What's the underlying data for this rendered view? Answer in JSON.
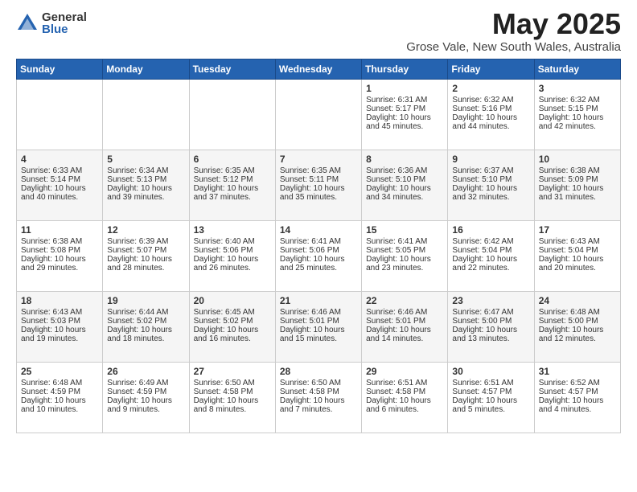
{
  "logo": {
    "general": "General",
    "blue": "Blue"
  },
  "title": "May 2025",
  "subtitle": "Grose Vale, New South Wales, Australia",
  "days_of_week": [
    "Sunday",
    "Monday",
    "Tuesday",
    "Wednesday",
    "Thursday",
    "Friday",
    "Saturday"
  ],
  "weeks": [
    [
      {
        "day": "",
        "sunrise": "",
        "sunset": "",
        "daylight": ""
      },
      {
        "day": "",
        "sunrise": "",
        "sunset": "",
        "daylight": ""
      },
      {
        "day": "",
        "sunrise": "",
        "sunset": "",
        "daylight": ""
      },
      {
        "day": "",
        "sunrise": "",
        "sunset": "",
        "daylight": ""
      },
      {
        "day": "1",
        "sunrise": "Sunrise: 6:31 AM",
        "sunset": "Sunset: 5:17 PM",
        "daylight": "Daylight: 10 hours and 45 minutes."
      },
      {
        "day": "2",
        "sunrise": "Sunrise: 6:32 AM",
        "sunset": "Sunset: 5:16 PM",
        "daylight": "Daylight: 10 hours and 44 minutes."
      },
      {
        "day": "3",
        "sunrise": "Sunrise: 6:32 AM",
        "sunset": "Sunset: 5:15 PM",
        "daylight": "Daylight: 10 hours and 42 minutes."
      }
    ],
    [
      {
        "day": "4",
        "sunrise": "Sunrise: 6:33 AM",
        "sunset": "Sunset: 5:14 PM",
        "daylight": "Daylight: 10 hours and 40 minutes."
      },
      {
        "day": "5",
        "sunrise": "Sunrise: 6:34 AM",
        "sunset": "Sunset: 5:13 PM",
        "daylight": "Daylight: 10 hours and 39 minutes."
      },
      {
        "day": "6",
        "sunrise": "Sunrise: 6:35 AM",
        "sunset": "Sunset: 5:12 PM",
        "daylight": "Daylight: 10 hours and 37 minutes."
      },
      {
        "day": "7",
        "sunrise": "Sunrise: 6:35 AM",
        "sunset": "Sunset: 5:11 PM",
        "daylight": "Daylight: 10 hours and 35 minutes."
      },
      {
        "day": "8",
        "sunrise": "Sunrise: 6:36 AM",
        "sunset": "Sunset: 5:10 PM",
        "daylight": "Daylight: 10 hours and 34 minutes."
      },
      {
        "day": "9",
        "sunrise": "Sunrise: 6:37 AM",
        "sunset": "Sunset: 5:10 PM",
        "daylight": "Daylight: 10 hours and 32 minutes."
      },
      {
        "day": "10",
        "sunrise": "Sunrise: 6:38 AM",
        "sunset": "Sunset: 5:09 PM",
        "daylight": "Daylight: 10 hours and 31 minutes."
      }
    ],
    [
      {
        "day": "11",
        "sunrise": "Sunrise: 6:38 AM",
        "sunset": "Sunset: 5:08 PM",
        "daylight": "Daylight: 10 hours and 29 minutes."
      },
      {
        "day": "12",
        "sunrise": "Sunrise: 6:39 AM",
        "sunset": "Sunset: 5:07 PM",
        "daylight": "Daylight: 10 hours and 28 minutes."
      },
      {
        "day": "13",
        "sunrise": "Sunrise: 6:40 AM",
        "sunset": "Sunset: 5:06 PM",
        "daylight": "Daylight: 10 hours and 26 minutes."
      },
      {
        "day": "14",
        "sunrise": "Sunrise: 6:41 AM",
        "sunset": "Sunset: 5:06 PM",
        "daylight": "Daylight: 10 hours and 25 minutes."
      },
      {
        "day": "15",
        "sunrise": "Sunrise: 6:41 AM",
        "sunset": "Sunset: 5:05 PM",
        "daylight": "Daylight: 10 hours and 23 minutes."
      },
      {
        "day": "16",
        "sunrise": "Sunrise: 6:42 AM",
        "sunset": "Sunset: 5:04 PM",
        "daylight": "Daylight: 10 hours and 22 minutes."
      },
      {
        "day": "17",
        "sunrise": "Sunrise: 6:43 AM",
        "sunset": "Sunset: 5:04 PM",
        "daylight": "Daylight: 10 hours and 20 minutes."
      }
    ],
    [
      {
        "day": "18",
        "sunrise": "Sunrise: 6:43 AM",
        "sunset": "Sunset: 5:03 PM",
        "daylight": "Daylight: 10 hours and 19 minutes."
      },
      {
        "day": "19",
        "sunrise": "Sunrise: 6:44 AM",
        "sunset": "Sunset: 5:02 PM",
        "daylight": "Daylight: 10 hours and 18 minutes."
      },
      {
        "day": "20",
        "sunrise": "Sunrise: 6:45 AM",
        "sunset": "Sunset: 5:02 PM",
        "daylight": "Daylight: 10 hours and 16 minutes."
      },
      {
        "day": "21",
        "sunrise": "Sunrise: 6:46 AM",
        "sunset": "Sunset: 5:01 PM",
        "daylight": "Daylight: 10 hours and 15 minutes."
      },
      {
        "day": "22",
        "sunrise": "Sunrise: 6:46 AM",
        "sunset": "Sunset: 5:01 PM",
        "daylight": "Daylight: 10 hours and 14 minutes."
      },
      {
        "day": "23",
        "sunrise": "Sunrise: 6:47 AM",
        "sunset": "Sunset: 5:00 PM",
        "daylight": "Daylight: 10 hours and 13 minutes."
      },
      {
        "day": "24",
        "sunrise": "Sunrise: 6:48 AM",
        "sunset": "Sunset: 5:00 PM",
        "daylight": "Daylight: 10 hours and 12 minutes."
      }
    ],
    [
      {
        "day": "25",
        "sunrise": "Sunrise: 6:48 AM",
        "sunset": "Sunset: 4:59 PM",
        "daylight": "Daylight: 10 hours and 10 minutes."
      },
      {
        "day": "26",
        "sunrise": "Sunrise: 6:49 AM",
        "sunset": "Sunset: 4:59 PM",
        "daylight": "Daylight: 10 hours and 9 minutes."
      },
      {
        "day": "27",
        "sunrise": "Sunrise: 6:50 AM",
        "sunset": "Sunset: 4:58 PM",
        "daylight": "Daylight: 10 hours and 8 minutes."
      },
      {
        "day": "28",
        "sunrise": "Sunrise: 6:50 AM",
        "sunset": "Sunset: 4:58 PM",
        "daylight": "Daylight: 10 hours and 7 minutes."
      },
      {
        "day": "29",
        "sunrise": "Sunrise: 6:51 AM",
        "sunset": "Sunset: 4:58 PM",
        "daylight": "Daylight: 10 hours and 6 minutes."
      },
      {
        "day": "30",
        "sunrise": "Sunrise: 6:51 AM",
        "sunset": "Sunset: 4:57 PM",
        "daylight": "Daylight: 10 hours and 5 minutes."
      },
      {
        "day": "31",
        "sunrise": "Sunrise: 6:52 AM",
        "sunset": "Sunset: 4:57 PM",
        "daylight": "Daylight: 10 hours and 4 minutes."
      }
    ]
  ]
}
